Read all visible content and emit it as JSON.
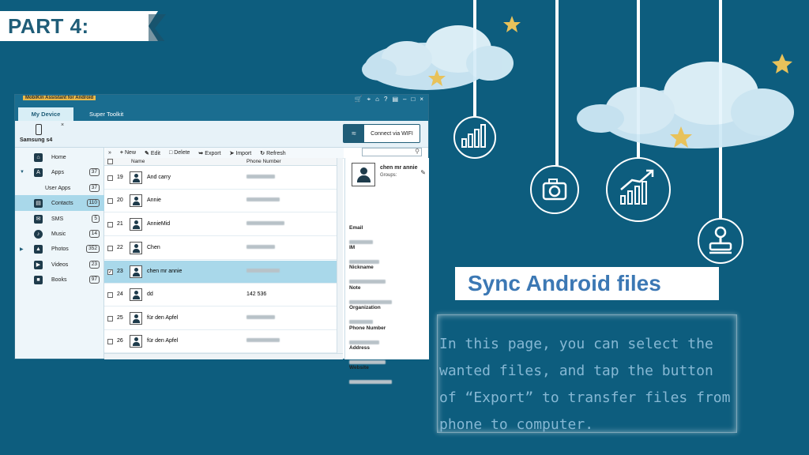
{
  "banner": {
    "title": "PART 4:"
  },
  "app": {
    "title": "MobiKin Assistant for Android",
    "tabs": [
      "My Device",
      "Super Toolkit"
    ],
    "device": {
      "name": "Samsung s4"
    },
    "wifi_button": "Connect via WIFI",
    "sidebar": [
      {
        "label": "Home",
        "icon": "home-icon",
        "count": ""
      },
      {
        "label": "Apps",
        "icon": "apps-icon",
        "count": "37"
      },
      {
        "label": "User Apps",
        "icon": "",
        "count": "37"
      },
      {
        "label": "Contacts",
        "icon": "contacts-icon",
        "count": "110"
      },
      {
        "label": "SMS",
        "icon": "sms-icon",
        "count": "5"
      },
      {
        "label": "Music",
        "icon": "music-icon",
        "count": "14"
      },
      {
        "label": "Photos",
        "icon": "photos-icon",
        "count": "352"
      },
      {
        "label": "Videos",
        "icon": "videos-icon",
        "count": "23"
      },
      {
        "label": "Books",
        "icon": "books-icon",
        "count": "97"
      }
    ],
    "toolbar": {
      "new": "New",
      "edit": "Edit",
      "delete": "Delete",
      "export": "Export",
      "import": "Import",
      "refresh": "Refresh"
    },
    "table": {
      "headers": {
        "name": "Name",
        "phone": "Phone Number"
      },
      "rows": [
        {
          "num": "19",
          "name": "And carry",
          "phone": "",
          "checked": false
        },
        {
          "num": "20",
          "name": "Annie",
          "phone": "",
          "checked": false
        },
        {
          "num": "21",
          "name": "AnnieMid",
          "phone": "",
          "checked": false
        },
        {
          "num": "22",
          "name": "Chen",
          "phone": "",
          "checked": false
        },
        {
          "num": "23",
          "name": "chen mr annie",
          "phone": "",
          "checked": true
        },
        {
          "num": "24",
          "name": "dd",
          "phone": "142 536",
          "checked": false
        },
        {
          "num": "25",
          "name": "für den Apfel",
          "phone": "",
          "checked": false
        },
        {
          "num": "26",
          "name": "für den Apfel",
          "phone": "",
          "checked": false
        }
      ]
    },
    "detail": {
      "name": "chen mr annie",
      "groups": "Groups:",
      "fields": [
        "Email",
        "IM",
        "Nickname",
        "Note",
        "Organization",
        "Phone Number",
        "Address",
        "Website"
      ]
    }
  },
  "heading": "Sync Android files",
  "description": "In this page, you can select the\nwanted files, and tap the button\nof “Export” to transfer files from\nphone to computer.",
  "colors": {
    "background": "#0d5d7e",
    "heading": "#3c78b4",
    "description": "#86b8d4",
    "selected_row": "#a9d8ea"
  }
}
